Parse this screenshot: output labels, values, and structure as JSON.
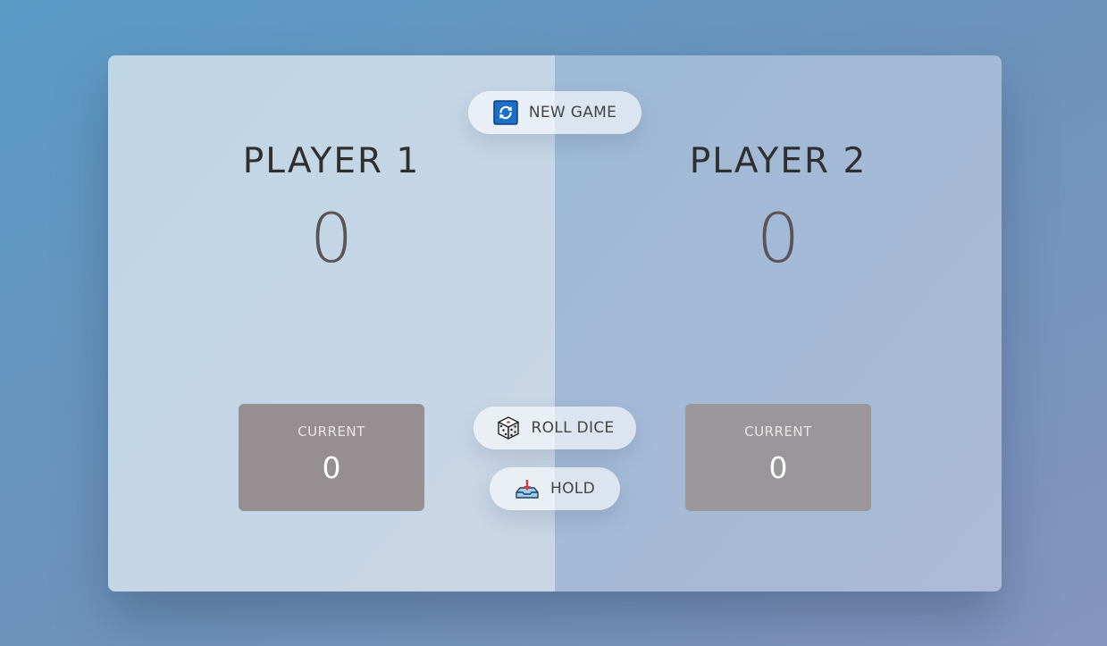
{
  "players": [
    {
      "name": "PLAYER 1",
      "score": "0",
      "current_label": "CURRENT",
      "current_score": "0"
    },
    {
      "name": "PLAYER 2",
      "score": "0",
      "current_label": "CURRENT",
      "current_score": "0"
    }
  ],
  "controls": {
    "new_game": {
      "label": "NEW GAME",
      "icon": "refresh-icon"
    },
    "roll_dice": {
      "label": "ROLL DICE",
      "icon": "dice-icon"
    },
    "hold": {
      "label": "HOLD",
      "icon": "inbox-tray-icon"
    }
  },
  "colors": {
    "player_1_panel": "#c3d6e5",
    "player_2_panel": "#a5bad6",
    "current_box": "#968f91",
    "score_text": "#5c5357",
    "name_text": "#2f2f2f"
  }
}
